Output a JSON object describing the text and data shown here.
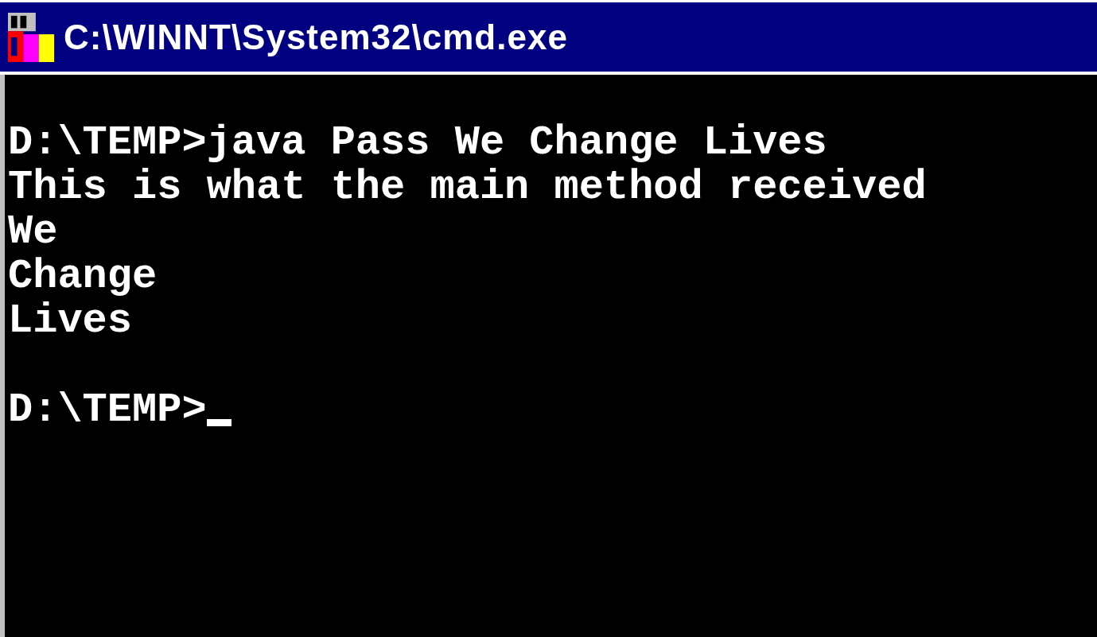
{
  "window": {
    "title": "C:\\WINNT\\System32\\cmd.exe"
  },
  "console": {
    "blocks": [
      [
        "D:\\TEMP>java Pass We Change Lives",
        "This is what the main method received",
        "We",
        "Change",
        "Lives"
      ]
    ],
    "prompt": "D:\\TEMP>"
  }
}
